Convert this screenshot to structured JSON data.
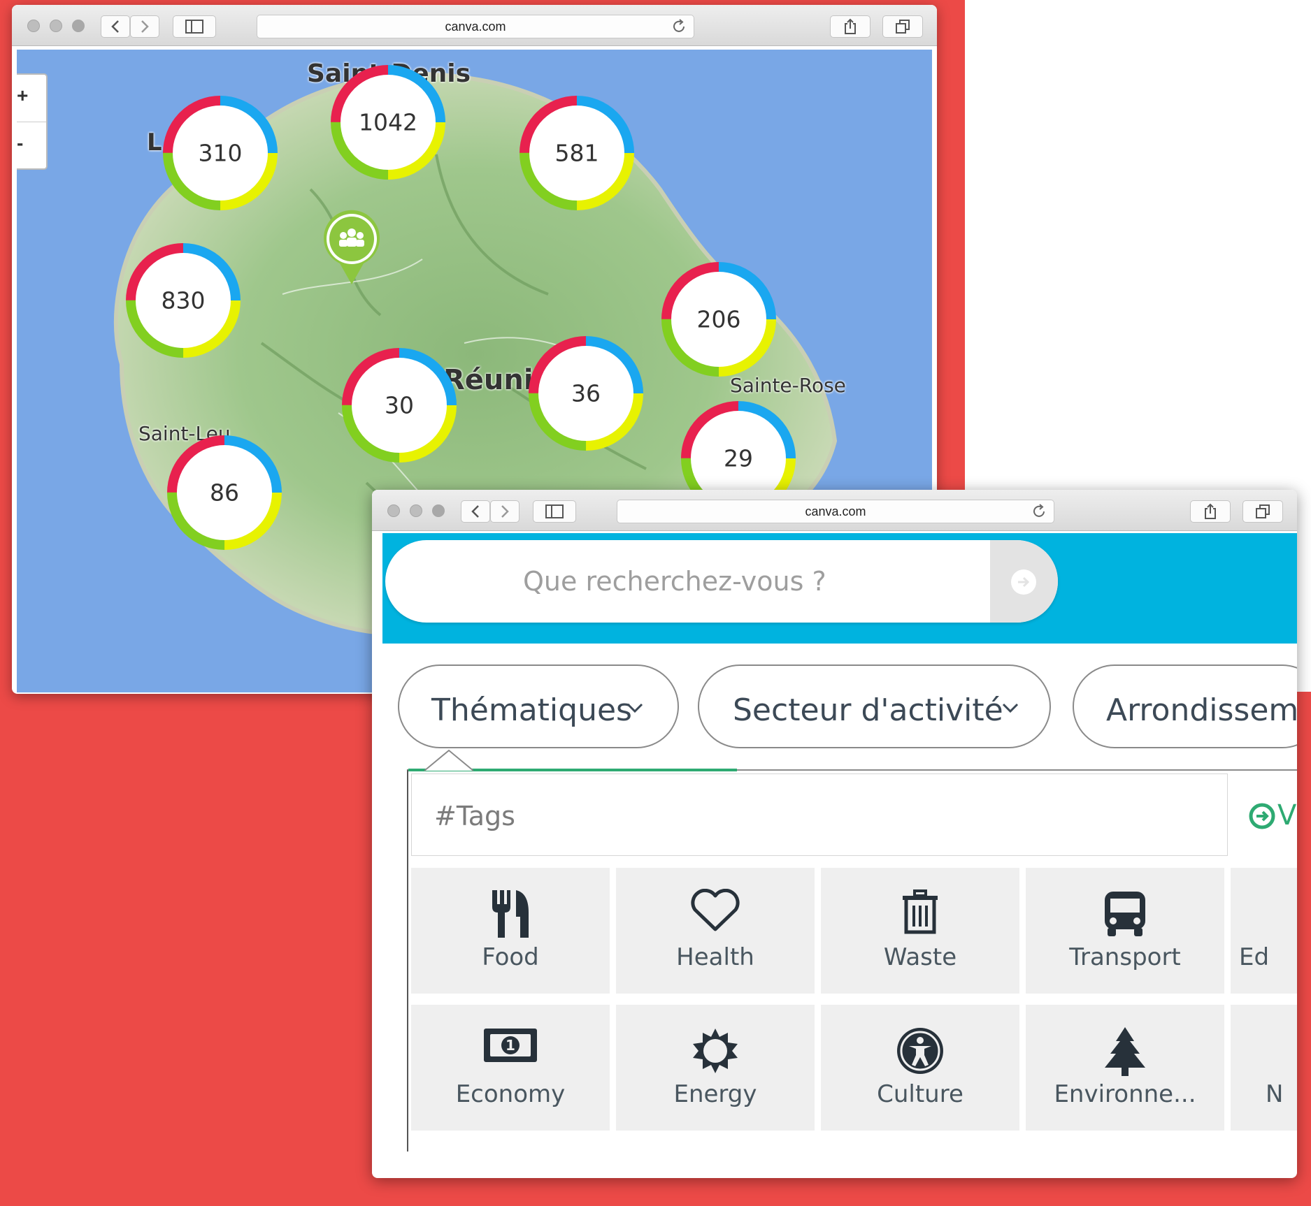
{
  "colors": {
    "background_red": "#EC4A47",
    "sea": "#79A7E6",
    "search_band": "#00B3DF",
    "tile_bg": "#EFEFEF",
    "accent_green": "#2EAA72"
  },
  "window1": {
    "url": "canva.com",
    "map": {
      "zoom_in": "+",
      "zoom_out": "-",
      "place_labels": [
        "Saint-Denis",
        "Réunion",
        "Sainte-Rose",
        "Saint-Leu",
        "L"
      ],
      "clusters": [
        {
          "count": "1042"
        },
        {
          "count": "310"
        },
        {
          "count": "581"
        },
        {
          "count": "830"
        },
        {
          "count": "206"
        },
        {
          "count": "30"
        },
        {
          "count": "36"
        },
        {
          "count": "29"
        },
        {
          "count": "86"
        }
      ],
      "marker_icon": "people-group-icon"
    }
  },
  "window2": {
    "url": "canva.com",
    "search": {
      "placeholder": "Que recherchez-vous ?",
      "submit_icon": "arrow-right-circle-icon"
    },
    "filters": [
      {
        "label": "Thématiques"
      },
      {
        "label": "Secteur d'activité"
      },
      {
        "label": "Arrondissement"
      }
    ],
    "tags_placeholder": "#Tags",
    "voir_label": "V",
    "themes": [
      {
        "label": "Food",
        "icon": "fork-knife-icon"
      },
      {
        "label": "Health",
        "icon": "heart-icon"
      },
      {
        "label": "Waste",
        "icon": "trash-icon"
      },
      {
        "label": "Transport",
        "icon": "bus-icon"
      },
      {
        "label": "Ed",
        "icon": ""
      },
      {
        "label": "Economy",
        "icon": "banknote-icon"
      },
      {
        "label": "Energy",
        "icon": "sun-icon"
      },
      {
        "label": "Culture",
        "icon": "accessibility-icon"
      },
      {
        "label": "Environne...",
        "icon": "tree-icon"
      },
      {
        "label": "N",
        "icon": ""
      }
    ]
  }
}
